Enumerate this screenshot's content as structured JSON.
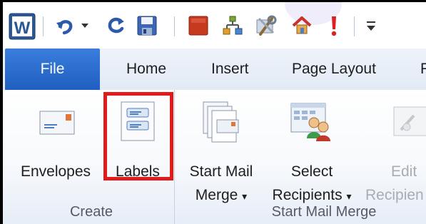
{
  "quick_access_icons": [
    "word-app-icon",
    "undo-icon",
    "dropdown-arrow-icon",
    "redo-icon",
    "save-icon",
    "red-square-icon",
    "network-icon",
    "tools-icon",
    "home-icon",
    "exclamation-icon",
    "customize-toolbar-icon"
  ],
  "tabs": {
    "file": "File",
    "home": "Home",
    "insert": "Insert",
    "page_layout": "Page Layout",
    "next_partial": "F"
  },
  "ribbon": {
    "create": {
      "group_label": "Create",
      "envelopes": "Envelopes",
      "labels": "Labels"
    },
    "start_mail_merge": {
      "group_label": "Start Mail Merge",
      "start_mail_merge_line1": "Start Mail",
      "start_mail_merge_line2": "Merge",
      "select_recipients_line1": "Select",
      "select_recipients_line2": "Recipients",
      "edit_recipients_line1": "Edit",
      "edit_recipients_line2": "Recipien"
    },
    "dropdown_arrow": "▾"
  },
  "annotation": {
    "highlight_color": "#e31a1a"
  },
  "colors": {
    "file_tab": "#2a6bd0",
    "tab_bar": "#e6edf7"
  }
}
